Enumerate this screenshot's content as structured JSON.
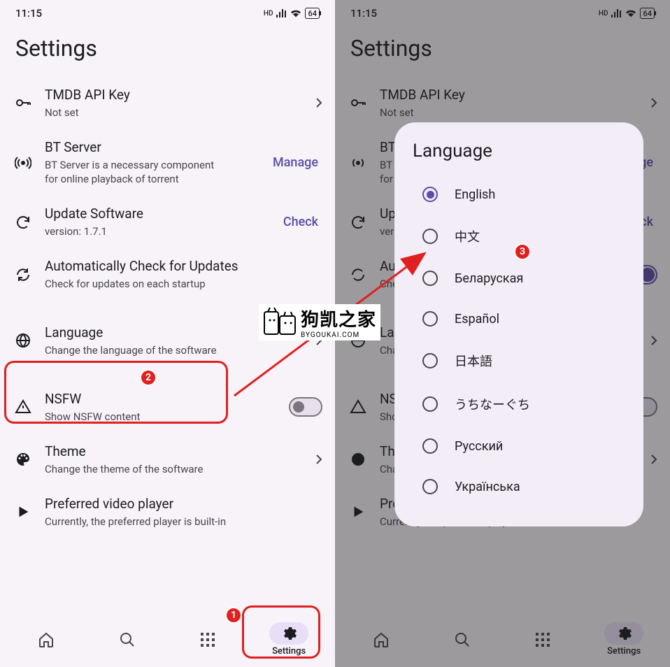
{
  "statusBar": {
    "time": "11:15",
    "hd": "HD",
    "battery": "64"
  },
  "pageTitle": "Settings",
  "rows": {
    "tmdb": {
      "title": "TMDB API Key",
      "sub": "Not set"
    },
    "bt": {
      "title": "BT Server",
      "sub": "BT Server is a necessary component for online playback of torrent",
      "action": "Manage"
    },
    "update": {
      "title": "Update Software",
      "sub": "version: 1.7.1",
      "action": "Check"
    },
    "autocheck": {
      "title": "Automatically Check for Updates",
      "sub": "Check for updates on each startup"
    },
    "language": {
      "title": "Language",
      "sub": "Change the language of the software"
    },
    "nsfw": {
      "title": "NSFW",
      "sub": "Show NSFW content"
    },
    "theme": {
      "title": "Theme",
      "sub": "Change the theme of the software"
    },
    "player": {
      "title": "Preferred video player",
      "sub": "Currently, the preferred player is built-in"
    }
  },
  "nav": {
    "settings": "Settings"
  },
  "dialog": {
    "title": "Language",
    "options": [
      "English",
      "中文",
      "Беларуская",
      "Español",
      "日本語",
      "うちなーぐち",
      "Русский",
      "Українська"
    ],
    "selected": 0
  },
  "badges": {
    "b1": "1",
    "b2": "2",
    "b3": "3"
  },
  "watermark": {
    "cn": "狗凯之家",
    "en": "BYGOUKAI.COM"
  }
}
